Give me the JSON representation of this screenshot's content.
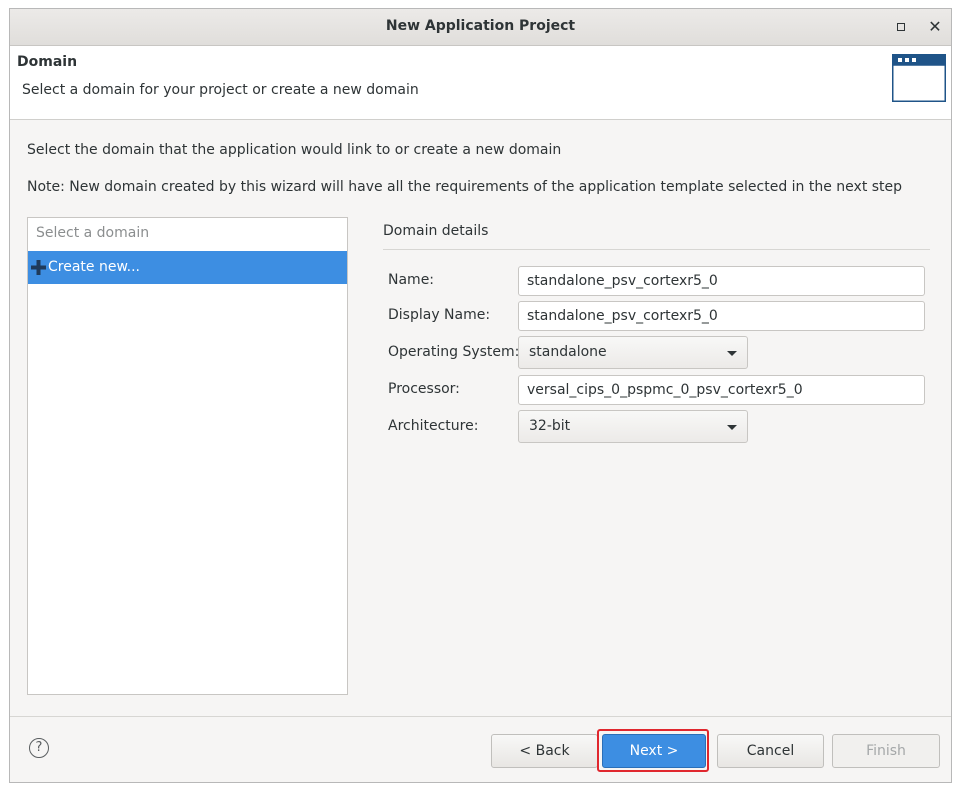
{
  "window": {
    "title": "New Application Project",
    "maximize_icon": "maximize-icon",
    "close_icon": "close-icon",
    "close_glyph": "✕"
  },
  "banner": {
    "title": "Domain",
    "subtitle": "Select a domain for your project or create a new domain",
    "icon": "window-icon"
  },
  "description": {
    "line1": "Select the domain that the application would link to or create a new domain",
    "line2": "Note: New domain created by this wizard will have all the requirements of the application template selected in the next step"
  },
  "domain_list": {
    "header": "Select a domain",
    "items": [
      {
        "label": "Create new...",
        "icon": "plus-icon",
        "selected": true
      }
    ]
  },
  "details": {
    "title": "Domain details",
    "name_label": "Name:",
    "name_value": "standalone_psv_cortexr5_0",
    "display_name_label": "Display Name:",
    "display_name_value": "standalone_psv_cortexr5_0",
    "os_label": "Operating System:",
    "os_value": "standalone",
    "processor_label": "Processor:",
    "processor_value": "versal_cips_0_pspmc_0_psv_cortexr5_0",
    "arch_label": "Architecture:",
    "arch_value": "32-bit"
  },
  "footer": {
    "help_glyph": "?",
    "back_label": "< Back",
    "next_label": "Next >",
    "cancel_label": "Cancel",
    "finish_label": "Finish"
  },
  "colors": {
    "accent": "#3d8ee2",
    "highlight_outline": "#e0272e",
    "banner_icon": "#1f5488"
  }
}
